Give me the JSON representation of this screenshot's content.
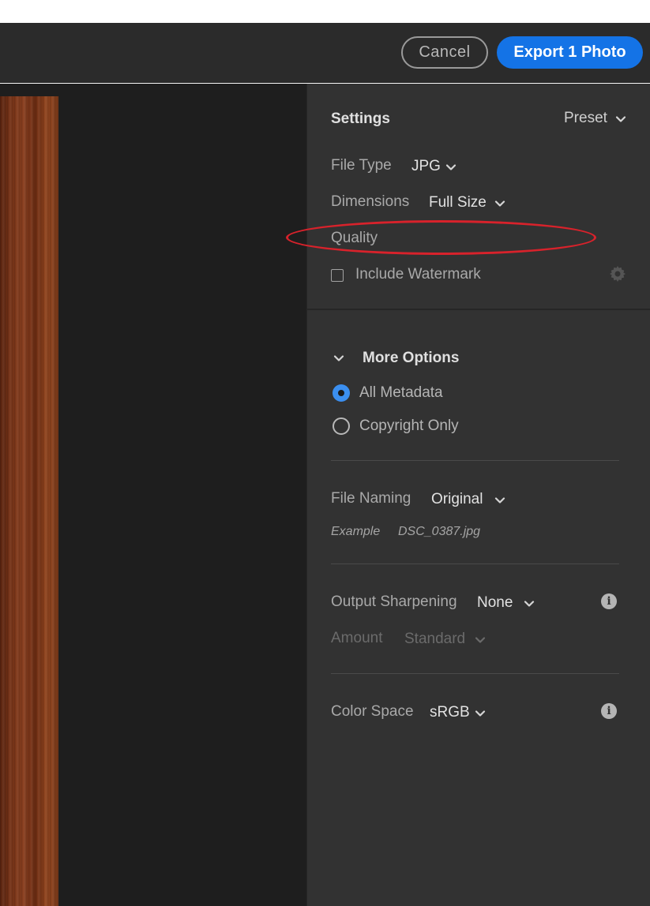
{
  "header": {
    "cancel_label": "Cancel",
    "export_label": "Export 1 Photo",
    "accent_color": "#1473e6"
  },
  "settings": {
    "title": "Settings",
    "preset_label": "Preset",
    "file_type": {
      "label": "File Type",
      "value": "JPG"
    },
    "dimensions": {
      "label": "Dimensions",
      "value": "Full Size"
    },
    "quality": {
      "label": "Quality"
    },
    "watermark": {
      "label": "Include Watermark",
      "checked": false
    }
  },
  "more_options": {
    "title": "More Options",
    "metadata_options": [
      {
        "label": "All Metadata",
        "selected": true
      },
      {
        "label": "Copyright Only",
        "selected": false
      }
    ],
    "file_naming": {
      "label": "File Naming",
      "value": "Original",
      "example_label": "Example",
      "example_value": "DSC_0387.jpg"
    },
    "output_sharpening": {
      "label": "Output Sharpening",
      "value": "None"
    },
    "amount": {
      "label": "Amount",
      "value": "Standard"
    },
    "color_space": {
      "label": "Color Space",
      "value": "sRGB"
    }
  },
  "icons": {
    "info": "i"
  },
  "annotation_color": "#d8222b"
}
